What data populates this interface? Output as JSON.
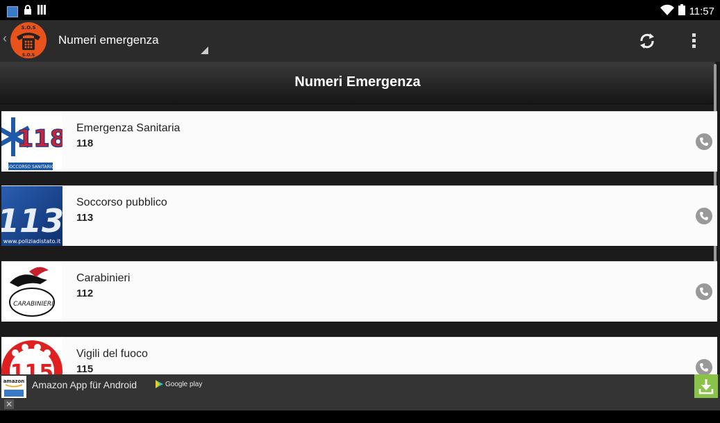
{
  "status": {
    "time": "11:57"
  },
  "actionbar": {
    "title": "Numeri emergenza"
  },
  "header": {
    "title": "Numeri Emergenza"
  },
  "items": [
    {
      "name": "Emergenza Sanitaria",
      "number": "118",
      "logo_text": "SOCCORSO SANITARIO"
    },
    {
      "name": "Soccorso pubblico",
      "number": "113",
      "logo_text": "www.poliziadistato.it"
    },
    {
      "name": "Carabinieri",
      "number": "112",
      "logo_text": "CARABINIERI"
    },
    {
      "name": "Vigili del fuoco",
      "number": "115",
      "logo_text": ""
    }
  ],
  "ad": {
    "text": "Amazon App für Android",
    "badge": "Google play",
    "logo_text": "amazon"
  },
  "colors": {
    "actionbar": "#2b2b2b",
    "row_bg": "#fbfbfb",
    "download": "#8bc34a",
    "call_icon": "#999999"
  }
}
